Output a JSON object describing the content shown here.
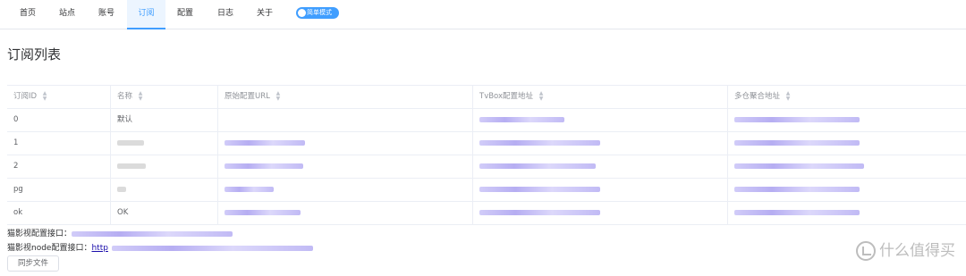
{
  "nav": {
    "items": [
      {
        "label": "首页"
      },
      {
        "label": "站点"
      },
      {
        "label": "账号"
      },
      {
        "label": "订阅",
        "active": true
      },
      {
        "label": "配置"
      },
      {
        "label": "日志"
      },
      {
        "label": "关于"
      }
    ],
    "mode_toggle": {
      "label": "简单模式",
      "on": true
    }
  },
  "page": {
    "title": "订阅列表"
  },
  "table": {
    "columns": [
      "订阅ID",
      "名称",
      "原始配置URL",
      "TvBox配置地址",
      "多仓聚合地址"
    ],
    "rows": [
      {
        "id": "0",
        "name": "默认",
        "source_url": "",
        "tvbox_url": "",
        "multi_url": ""
      },
      {
        "id": "1",
        "name": "",
        "source_url": "",
        "tvbox_url": "",
        "multi_url": ""
      },
      {
        "id": "2",
        "name": "",
        "source_url": "",
        "tvbox_url": "",
        "multi_url": ""
      },
      {
        "id": "pg",
        "name": "",
        "source_url": "",
        "tvbox_url": "",
        "multi_url": ""
      },
      {
        "id": "ok",
        "name": "OK",
        "source_url": "",
        "tvbox_url": "",
        "multi_url": ""
      }
    ]
  },
  "footer": {
    "cat_api_label": "猫影视配置接口：",
    "cat_node_api_label": "猫影视node配置接口：",
    "cat_node_api_link": "http",
    "sync_button": "同步文件"
  },
  "watermark": {
    "text": "什么值得买"
  },
  "colors": {
    "accent": "#409eff",
    "redaction": "#b6aef3",
    "link": "#1a0dab"
  }
}
